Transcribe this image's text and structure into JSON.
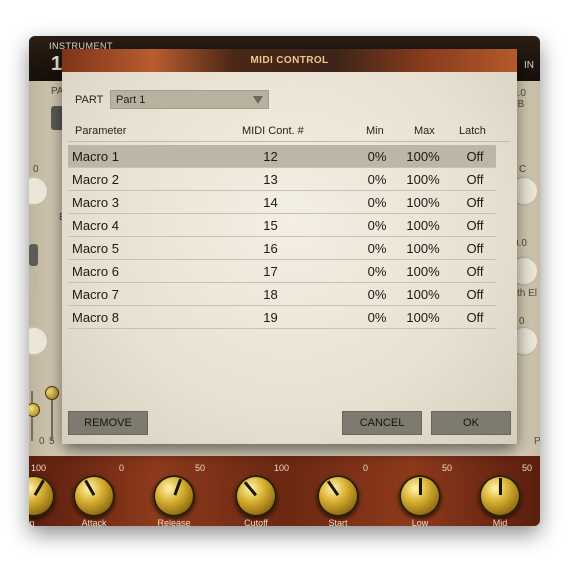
{
  "background_app": {
    "instrument_label": "INSTRUMENT",
    "instrument_number": "1",
    "fragments": {
      "pa": "PA",
      "in": "IN",
      "db": "0.0 dB",
      "zero_left": "0",
      "c_right": "C",
      "zero_point": "0.0",
      "th_el": "th  El",
      "zero_right": "0",
      "zero_small_left": "0",
      "five_left": "5",
      "e_label": "E",
      "p_right": "P"
    },
    "ticks": [
      "100",
      "0",
      "50",
      "100",
      "0",
      "50",
      "50"
    ],
    "knobs": [
      {
        "label": "Attack",
        "angle": -30
      },
      {
        "label": "Release",
        "angle": 20
      },
      {
        "label": "Cutoff",
        "angle": -40
      },
      {
        "label": "Start",
        "angle": -35
      },
      {
        "label": "Low",
        "angle": 0
      },
      {
        "label": "Mid",
        "angle": 0
      }
    ],
    "left_knob_label": "n"
  },
  "dialog": {
    "title": "MIDI CONTROL",
    "part_label": "PART",
    "part_value": "Part 1",
    "headers": {
      "parameter": "Parameter",
      "midi_cc": "MIDI Cont. #",
      "min": "Min",
      "max": "Max",
      "latch": "Latch"
    },
    "rows": [
      {
        "name": "Macro 1",
        "cc": "12",
        "min": "0%",
        "max": "100%",
        "latch": "Off"
      },
      {
        "name": "Macro 2",
        "cc": "13",
        "min": "0%",
        "max": "100%",
        "latch": "Off"
      },
      {
        "name": "Macro 3",
        "cc": "14",
        "min": "0%",
        "max": "100%",
        "latch": "Off"
      },
      {
        "name": "Macro 4",
        "cc": "15",
        "min": "0%",
        "max": "100%",
        "latch": "Off"
      },
      {
        "name": "Macro 5",
        "cc": "16",
        "min": "0%",
        "max": "100%",
        "latch": "Off"
      },
      {
        "name": "Macro 6",
        "cc": "17",
        "min": "0%",
        "max": "100%",
        "latch": "Off"
      },
      {
        "name": "Macro 7",
        "cc": "18",
        "min": "0%",
        "max": "100%",
        "latch": "Off"
      },
      {
        "name": "Macro 8",
        "cc": "19",
        "min": "0%",
        "max": "100%",
        "latch": "Off"
      }
    ],
    "buttons": {
      "remove": "REMOVE",
      "cancel": "CANCEL",
      "ok": "OK"
    }
  }
}
